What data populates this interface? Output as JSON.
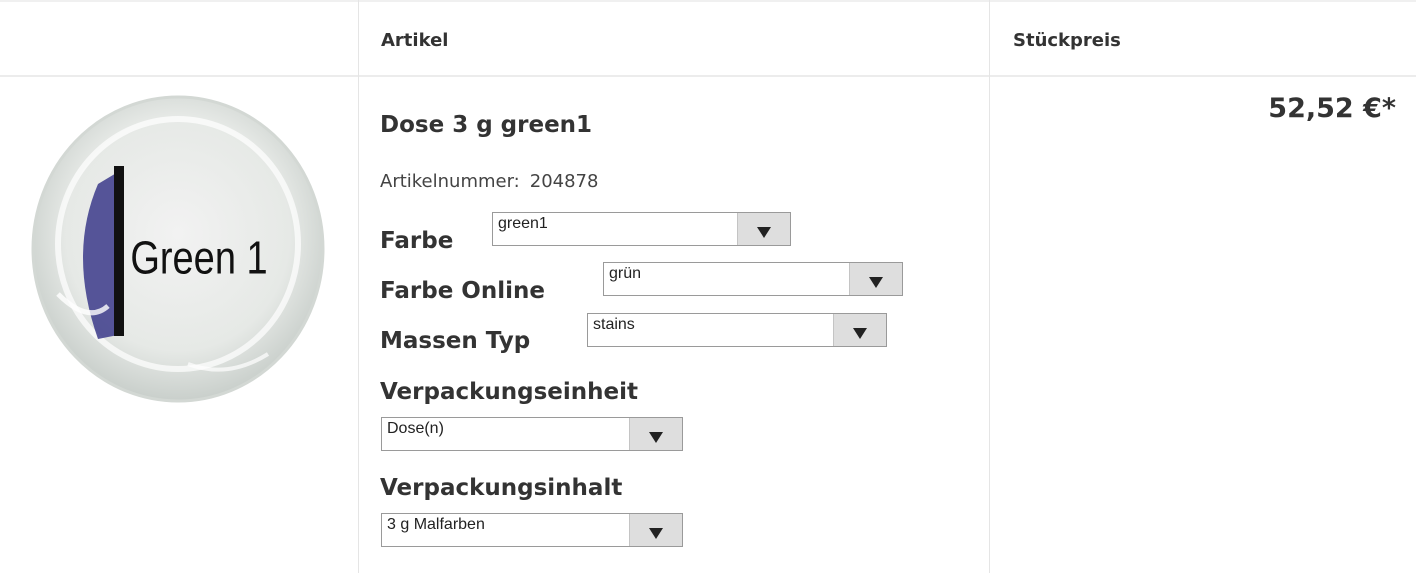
{
  "header": {
    "col_article": "Artikel",
    "col_price": "Stückpreis"
  },
  "product": {
    "title": "Dose 3 g green1",
    "article_number_label": "Artikelnummer:",
    "article_number": "204878",
    "image_text": "Green 1",
    "price": "52,52 €*"
  },
  "options": {
    "farbe": {
      "label": "Farbe",
      "value": "green1"
    },
    "farbe_online": {
      "label": "Farbe Online",
      "value": "grün"
    },
    "massen_typ": {
      "label": "Massen Typ",
      "value": "stains"
    },
    "verpackungseinheit": {
      "label": "Verpackungseinheit",
      "value": "Dose(n)"
    },
    "verpackungsinhalt": {
      "label": "Verpackungsinhalt",
      "value": "3 g Malfarben"
    }
  },
  "colors": {
    "jar_label_blue": "#3b3a8a",
    "select_button": "#dedede"
  }
}
